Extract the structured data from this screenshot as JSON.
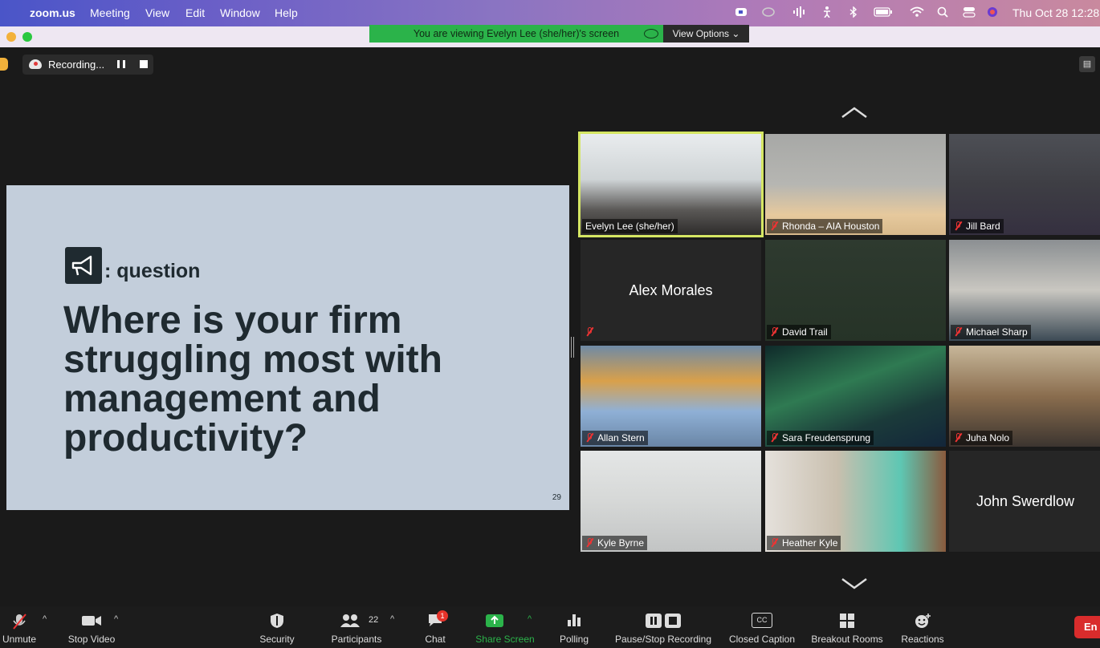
{
  "menubar": {
    "app": "zoom.us",
    "items": [
      "Meeting",
      "View",
      "Edit",
      "Window",
      "Help"
    ],
    "clock": "Thu Oct 28  12:28"
  },
  "banner": {
    "text": "You are viewing Evelyn Lee (she/her)'s screen",
    "view_options": "View Options ⌄",
    "color": "#2bb34a"
  },
  "recording": {
    "label": "Recording..."
  },
  "slide": {
    "tag": ": question",
    "question": "Where is your firm struggling most with management and productivity?",
    "page_number": "29"
  },
  "participants_grid": [
    {
      "name": "Evelyn Lee (she/her)",
      "muted": false,
      "video": true,
      "active": true
    },
    {
      "name": "Rhonda – AIA Houston",
      "muted": true,
      "video": true
    },
    {
      "name": "Jill Bard",
      "muted": true,
      "video": true
    },
    {
      "name": "Alex Morales",
      "muted": true,
      "video": false
    },
    {
      "name": "David Trail",
      "muted": true,
      "video": true
    },
    {
      "name": "Michael Sharp",
      "muted": true,
      "video": true
    },
    {
      "name": "Allan Stern",
      "muted": true,
      "video": true
    },
    {
      "name": "Sara Freudensprung",
      "muted": true,
      "video": true
    },
    {
      "name": "Juha Nolo",
      "muted": true,
      "video": true
    },
    {
      "name": "Kyle Byrne",
      "muted": false,
      "video": true
    },
    {
      "name": "Heather Kyle",
      "muted": true,
      "video": true
    },
    {
      "name": "John Swerdlow",
      "muted": false,
      "video": false
    }
  ],
  "toolbar": {
    "unmute": "Unmute",
    "stop_video": "Stop Video",
    "security": "Security",
    "participants": "Participants",
    "participants_count": "22",
    "chat": "Chat",
    "chat_badge": "1",
    "share_screen": "Share Screen",
    "polling": "Polling",
    "pause_stop_recording": "Pause/Stop Recording",
    "closed_caption": "Closed Caption",
    "closed_caption_icon_text": "CC",
    "breakout_rooms": "Breakout Rooms",
    "reactions": "Reactions",
    "end": "En"
  },
  "colors": {
    "share_green": "#2bb34a",
    "end_red": "#d92c2c",
    "active_speaker": "#d5e663"
  }
}
